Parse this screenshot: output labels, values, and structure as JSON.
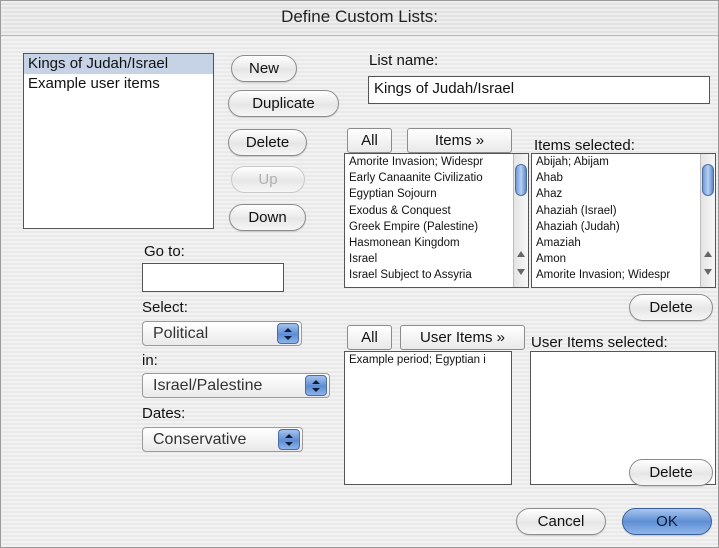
{
  "window": {
    "title": "Define Custom Lists:"
  },
  "lists_panel": {
    "items": [
      {
        "label": "Kings of Judah/Israel",
        "selected": true
      },
      {
        "label": "Example user items",
        "selected": false
      }
    ]
  },
  "list_buttons": {
    "new": "New",
    "duplicate": "Duplicate",
    "delete": "Delete",
    "up": "Up",
    "down": "Down"
  },
  "goto": {
    "label": "Go to:",
    "value": ""
  },
  "select": {
    "label": "Select:",
    "value": "Political"
  },
  "in": {
    "label": "in:",
    "value": "Israel/Palestine"
  },
  "dates": {
    "label": "Dates:",
    "value": "Conservative"
  },
  "list_name": {
    "label": "List name:",
    "value": "Kings of Judah/Israel"
  },
  "items_section": {
    "all_button": "All",
    "items_button": "Items »",
    "selected_label": "Items selected:",
    "available": [
      "Amorite Invasion; Widespr",
      "Early Canaanite Civilizatio",
      "Egyptian Sojourn",
      "Exodus & Conquest",
      "Greek Empire (Palestine)",
      "Hasmonean Kingdom",
      "Israel",
      "Israel Subject to Assyria"
    ],
    "selected": [
      "Abijah; Abijam",
      "Ahab",
      "Ahaz",
      "Ahaziah (Israel)",
      "Ahaziah (Judah)",
      "Amaziah",
      "Amon",
      "Amorite Invasion; Widespr"
    ],
    "delete_button": "Delete"
  },
  "user_items_section": {
    "all_button": "All",
    "user_items_button": "User Items »",
    "selected_label": "User Items selected:",
    "available": [
      "Example period; Egyptian i"
    ],
    "selected": [],
    "delete_button": "Delete"
  },
  "footer": {
    "cancel": "Cancel",
    "ok": "OK"
  },
  "colors": {
    "selection": "#c6d2e6",
    "accent": "#5f8fd4"
  }
}
